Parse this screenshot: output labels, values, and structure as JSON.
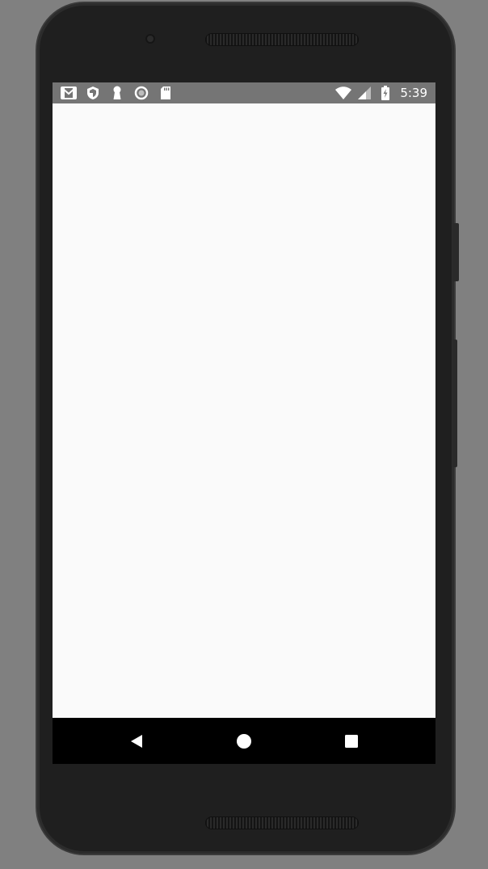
{
  "status_bar": {
    "time": "5:39",
    "background_color": "#757575",
    "left_icons": [
      "gmail-icon",
      "shield-icon",
      "keyhole-icon",
      "circle-icon",
      "sd-card-icon"
    ],
    "right_icons": [
      "wifi-icon",
      "cell-signal-icon",
      "battery-charging-icon"
    ]
  },
  "navigation_bar": {
    "background_color": "#000000",
    "buttons": [
      "back-icon",
      "home-icon",
      "recents-icon"
    ]
  },
  "content": {
    "background_color": "#fafafa"
  }
}
